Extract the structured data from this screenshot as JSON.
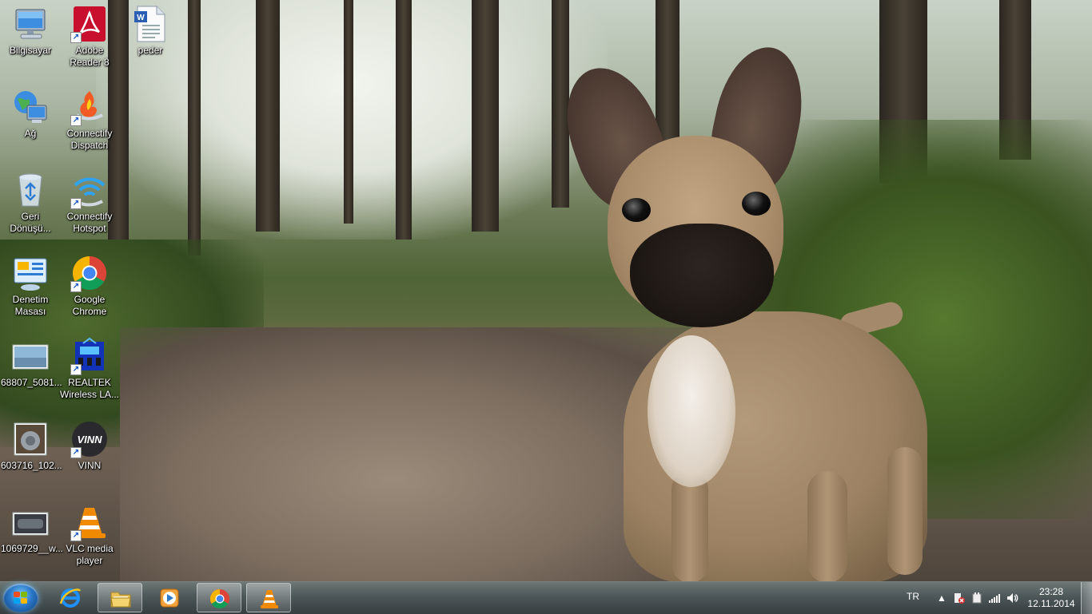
{
  "desktop": {
    "icons": [
      {
        "label": "Bilgisayar",
        "icon": "computer-icon"
      },
      {
        "label": "Adobe\nReader 8",
        "icon": "adobe-reader-icon"
      },
      {
        "label": "peder",
        "icon": "word-document-icon"
      },
      {
        "label": "Ağ",
        "icon": "network-icon"
      },
      {
        "label": "Connectify\nDispatch",
        "icon": "connectify-dispatch-icon"
      },
      {
        "label": "Geri\nDönüşü...",
        "icon": "recycle-bin-icon"
      },
      {
        "label": "Connectify\nHotspot",
        "icon": "connectify-hotspot-icon"
      },
      {
        "label": "Denetim\nMasası",
        "icon": "control-panel-icon"
      },
      {
        "label": "Google\nChrome",
        "icon": "chrome-icon"
      },
      {
        "label": "68807_5081...",
        "icon": "image-file-icon"
      },
      {
        "label": "REALTEK\nWireless LA...",
        "icon": "realtek-icon"
      },
      {
        "label": "603716_102...",
        "icon": "image-file-icon"
      },
      {
        "label": "VINN",
        "icon": "vinn-icon"
      },
      {
        "label": "1069729__w...",
        "icon": "image-file-icon"
      },
      {
        "label": "VLC media\nplayer",
        "icon": "vlc-icon"
      }
    ],
    "vinn_logo_text": "VINN"
  },
  "taskbar": {
    "start": "start-orb",
    "buttons": [
      {
        "name": "internet-explorer",
        "state": "pinned"
      },
      {
        "name": "windows-explorer",
        "state": "running"
      },
      {
        "name": "windows-media-player",
        "state": "pinned"
      },
      {
        "name": "google-chrome",
        "state": "running"
      },
      {
        "name": "vlc-media-player",
        "state": "running"
      }
    ],
    "tray": {
      "language": "TR",
      "icons": [
        "show-hidden-icons",
        "action-center-icon",
        "power-icon",
        "network-signal-icon",
        "volume-icon"
      ]
    },
    "clock": {
      "time": "23:28",
      "date": "12.11.2014"
    }
  },
  "colors": {
    "taskbar": "#4a545a",
    "accent_blue": "#2a78c8",
    "chrome_red": "#db4437",
    "vlc_orange": "#f08a00"
  }
}
